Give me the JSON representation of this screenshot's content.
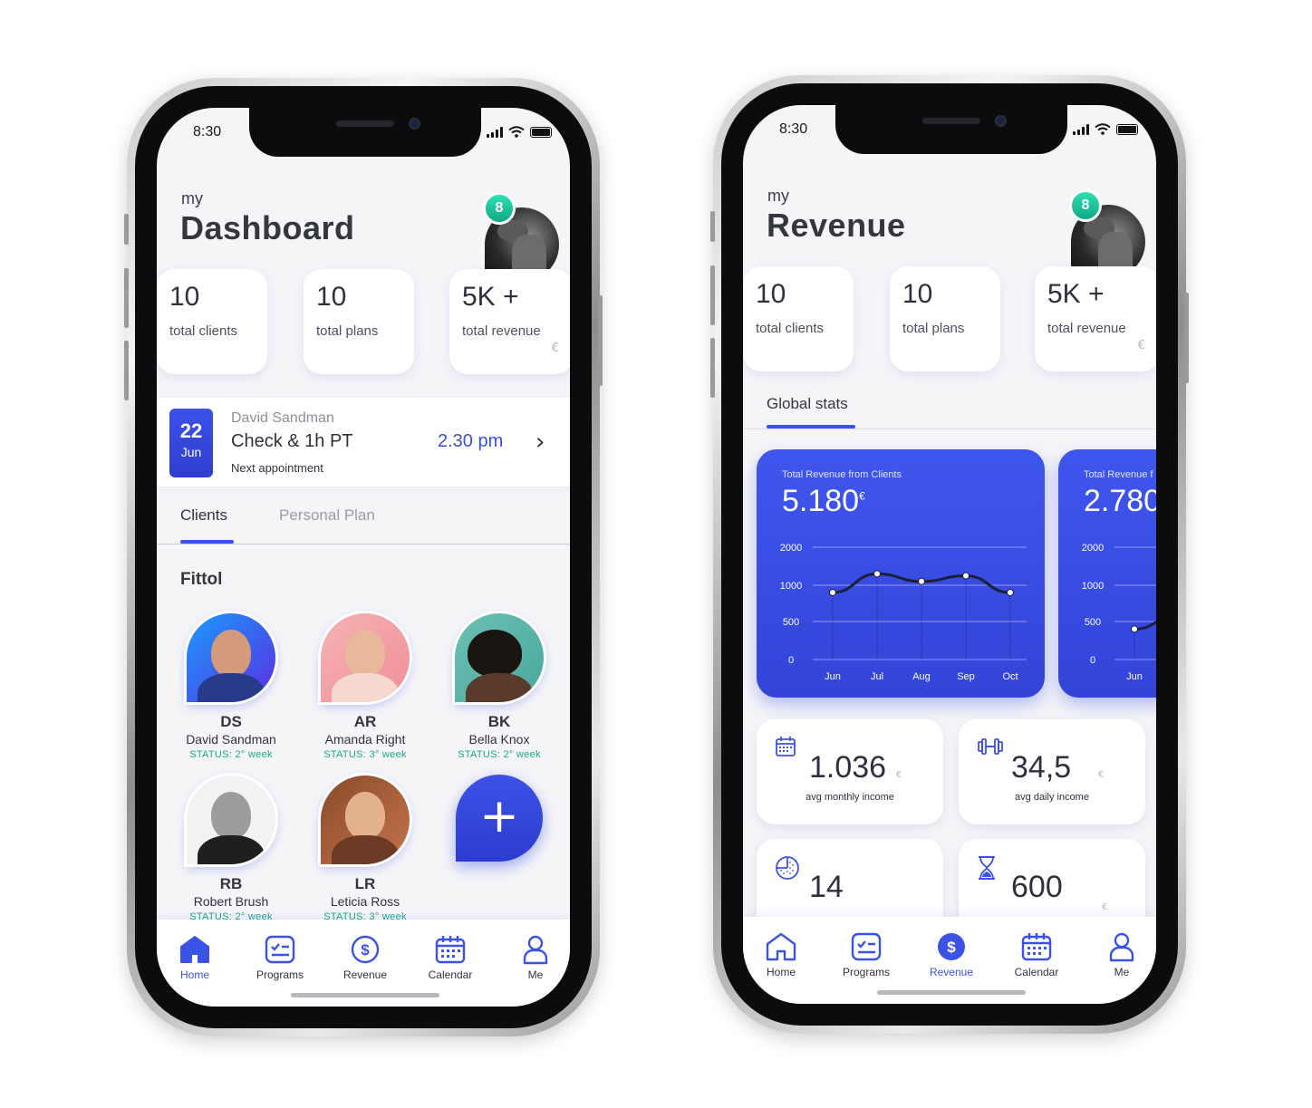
{
  "status_bar": {
    "time": "8:30"
  },
  "notification_count": "8",
  "stats": [
    {
      "value": "10",
      "label": "total clients",
      "currency": ""
    },
    {
      "value": "10",
      "label": "total plans",
      "currency": ""
    },
    {
      "value": "5K +",
      "label": "total revenue",
      "currency": "€"
    }
  ],
  "dashboard": {
    "greeting": "my",
    "title": "Dashboard",
    "appointment": {
      "day": "22",
      "month": "Jun",
      "client": "David Sandman",
      "session": "Check & 1h PT",
      "time": "2.30 pm",
      "caption": "Next appointment"
    },
    "tabs": [
      "Clients",
      "Personal Plan"
    ],
    "section_title": "Fittol",
    "clients": [
      {
        "initials": "DS",
        "name": "David Sandman",
        "status": "STATUS: 2° week"
      },
      {
        "initials": "AR",
        "name": "Amanda Right",
        "status": "STATUS: 3° week"
      },
      {
        "initials": "BK",
        "name": "Bella Knox",
        "status": "STATUS: 2° week"
      },
      {
        "initials": "RB",
        "name": "Robert Brush",
        "status": "STATUS: 2° week"
      },
      {
        "initials": "LR",
        "name": "Leticia Ross",
        "status": "STATUS: 3° week"
      }
    ],
    "add_label": "+"
  },
  "revenue": {
    "greeting": "my",
    "title": "Revenue",
    "tab": "Global stats",
    "metrics": [
      {
        "icon": "calendar-icon",
        "value": "1.036",
        "currency": "€",
        "label": "avg monthly income"
      },
      {
        "icon": "dumbbell-icon",
        "value": "34,5",
        "currency": "€",
        "label": "avg daily income"
      },
      {
        "icon": "pie-chart-icon",
        "value": "14",
        "currency": "",
        "label": ""
      },
      {
        "icon": "hourglass-icon",
        "value": "600",
        "currency": "€",
        "label": ""
      }
    ]
  },
  "chart_data": [
    {
      "type": "line",
      "title": "Total Revenue from Clients",
      "total": "5.180",
      "currency": "€",
      "categories": [
        "Jun",
        "Jul",
        "Aug",
        "Sep",
        "Oct"
      ],
      "values": [
        900,
        1300,
        1100,
        1250,
        900
      ],
      "yticks": [
        "2000",
        "1000",
        "500",
        "0"
      ],
      "ytick_values": [
        2000,
        1000,
        500,
        0
      ]
    },
    {
      "type": "line",
      "title": "Total Revenue f",
      "total": "2.780",
      "currency": "",
      "categories": [
        "Jun"
      ],
      "values": [
        400,
        600
      ],
      "yticks": [
        "2000",
        "1000",
        "500",
        "0"
      ],
      "ytick_values": [
        2000,
        1000,
        500,
        0
      ]
    }
  ],
  "nav": [
    {
      "icon": "home-icon",
      "label": "Home"
    },
    {
      "icon": "programs-icon",
      "label": "Programs"
    },
    {
      "icon": "dollar-icon",
      "label": "Revenue"
    },
    {
      "icon": "calendar-icon",
      "label": "Calendar"
    },
    {
      "icon": "user-icon",
      "label": "Me"
    }
  ],
  "colors": {
    "accent": "#3b52e6",
    "status_green": "#1aa88a",
    "badge": "#1dc9a0",
    "background": "#f5f5f8"
  }
}
